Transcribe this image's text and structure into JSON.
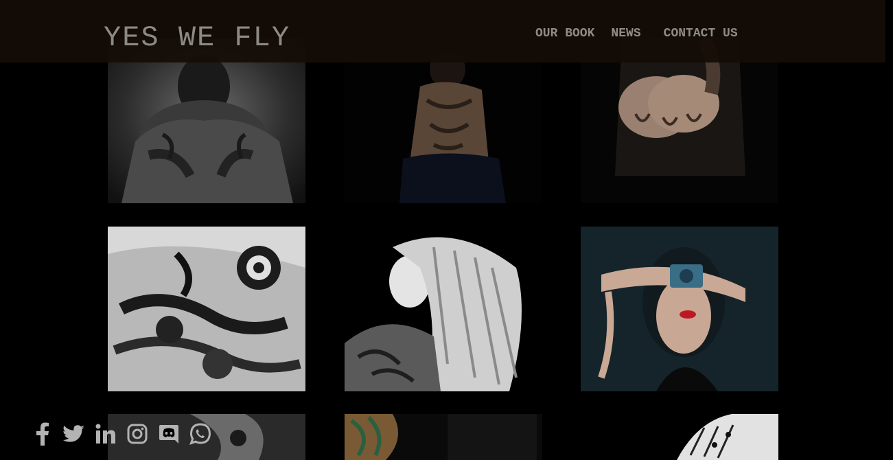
{
  "header": {
    "logo_text": "YES WE FLY",
    "nav": [
      {
        "label": "OUR BOOK"
      },
      {
        "label": "NEWS"
      },
      {
        "label": "CONTACT US"
      }
    ]
  },
  "gallery": {
    "tiles": [
      {
        "subject": "tattooed man crouching, black and white"
      },
      {
        "subject": "woman with back tattoo in dark"
      },
      {
        "subject": "tattooed hands clasped"
      },
      {
        "subject": "tattooed arm with rose, black and white"
      },
      {
        "subject": "woman with blonde dreadlocks and shoulder tattoo"
      },
      {
        "subject": "woman with camera tattoo covering eyes"
      },
      {
        "subject": "tattooed arm partial"
      },
      {
        "subject": "colorful sleeve tattoo partial"
      },
      {
        "subject": "tattooed hand partial"
      }
    ]
  },
  "social": {
    "icons": [
      "facebook-icon",
      "twitter-icon",
      "linkedin-icon",
      "instagram-icon",
      "discord-icon",
      "whatsapp-icon"
    ],
    "icon_color": "#b3b3b3"
  },
  "colors": {
    "background": "#000000",
    "header_bg": "#140c06",
    "text_muted": "#8d8a86"
  }
}
